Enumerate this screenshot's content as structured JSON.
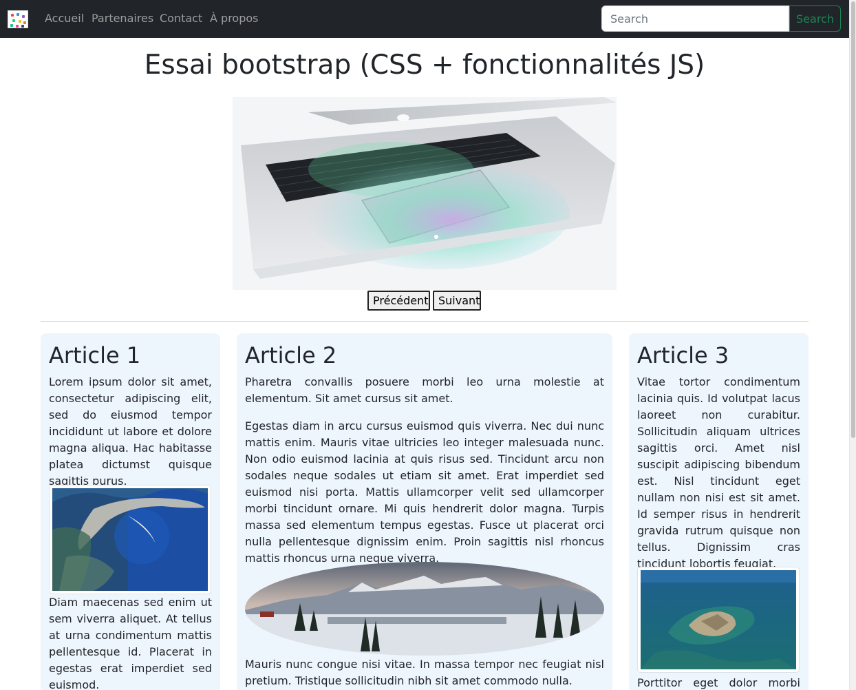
{
  "nav": {
    "links": [
      "Accueil",
      "Partenaires",
      "Contact",
      "À propos"
    ],
    "search_placeholder": "Search",
    "search_button": "Search"
  },
  "header": {
    "title": "Essai bootstrap (CSS + fonctionnalités JS)"
  },
  "carousel": {
    "prev_label": "Précédent",
    "next_label": "Suivant"
  },
  "articles": [
    {
      "title": "Article 1",
      "paragraphs": [
        "Lorem ipsum dolor sit amet, consectetur adipiscing elit, sed do eiusmod tempor incididunt ut labore et dolore magna aliqua. Hac habitasse platea dictumst quisque sagittis purus.",
        "Diam maecenas sed enim ut sem viverra aliquet. At tellus at urna condimentum mattis pellentesque id. Placerat in egestas erat imperdiet sed euismod."
      ]
    },
    {
      "title": "Article 2",
      "paragraphs": [
        "Pharetra convallis posuere morbi leo urna molestie at elementum. Sit amet cursus sit amet.",
        "Egestas diam in arcu cursus euismod quis viverra. Nec dui nunc mattis enim. Mauris vitae ultricies leo integer malesuada nunc. Non odio euismod lacinia at quis risus sed. Tincidunt arcu non sodales neque sodales ut etiam sit amet. Erat imperdiet sed euismod nisi porta. Mattis ullamcorper velit sed ullamcorper morbi tincidunt ornare. Mi quis hendrerit dolor magna. Turpis massa sed elementum tempus egestas. Fusce ut placerat orci nulla pellentesque dignissim enim. Proin sagittis nisl rhoncus mattis rhoncus urna neque viverra.",
        "Mauris nunc congue nisi vitae. In massa tempor nec feugiat nisl pretium. Tristique sollicitudin nibh sit amet commodo nulla."
      ]
    },
    {
      "title": "Article 3",
      "paragraphs": [
        "Vitae tortor condimentum lacinia quis. Id volutpat lacus laoreet non curabitur. Sollicitudin aliquam ultrices sagittis orci. Amet nisl suscipit adipiscing bibendum est. Nisl tincidunt eget nullam non nisi est sit amet. Id semper risus in hendrerit gravida rutrum quisque non tellus. Dignissim cras tincidunt lobortis feugiat.",
        "Porttitor eget dolor morbi non"
      ]
    }
  ],
  "colors": {
    "navbar_bg": "#212529",
    "article_bg": "#eef6fd",
    "search_accent": "#198754"
  },
  "icons": {
    "brand": "brand-logo-icon"
  }
}
